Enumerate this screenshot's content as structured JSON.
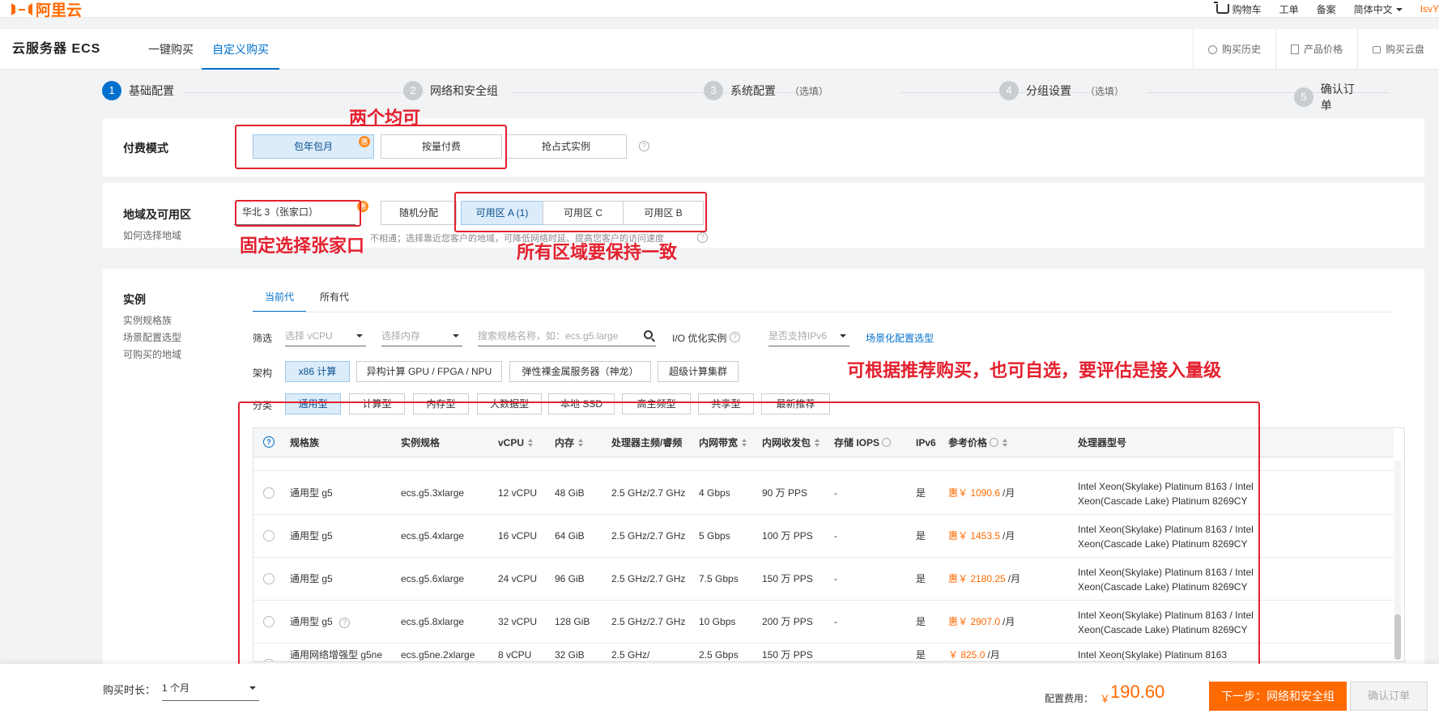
{
  "topbar": {
    "logo_text": "阿里云",
    "links": [
      "购物车",
      "工单",
      "备案",
      "简体中文"
    ],
    "user": "IsvY"
  },
  "product": {
    "title": "云服务器 ECS",
    "tabs": [
      {
        "label": "一键购买",
        "active": false
      },
      {
        "label": "自定义购买",
        "active": true
      }
    ],
    "right_links": [
      "购买历史",
      "产品价格",
      "购买云盘"
    ]
  },
  "steps": [
    {
      "num": "1",
      "label": "基础配置",
      "optional": "",
      "active": true
    },
    {
      "num": "2",
      "label": "网络和安全组",
      "optional": "",
      "active": false
    },
    {
      "num": "3",
      "label": "系统配置",
      "optional": "（选填）",
      "active": false
    },
    {
      "num": "4",
      "label": "分组设置",
      "optional": "（选填）",
      "active": false
    },
    {
      "num": "5",
      "label": "确认订单",
      "optional": "",
      "active": false
    }
  ],
  "billing": {
    "label": "付费模式",
    "options": [
      "包年包月",
      "按量付费",
      "抢占式实例"
    ],
    "selected": "包年包月",
    "badge": "惠"
  },
  "region": {
    "label": "地域及可用区",
    "help_link": "如何选择地域",
    "region_value": "华北 3（张家口）",
    "random": "随机分配",
    "zones": [
      "可用区 A (1)",
      "可用区 C",
      "可用区 B"
    ],
    "badge": "惠",
    "hint_a": "不相通；选择靠近您客户的地域，可降低网络时延、提高您客户的访问速度"
  },
  "annotations": {
    "billing_note": "两个均可",
    "region_note": "固定选择张家口",
    "zone_note": "所有区域要保持一致",
    "table_note": "可根据推荐购买，也可自选，要评估是接入量级",
    "color": "#e4202e"
  },
  "instance": {
    "label": "实例",
    "nav": [
      "实例规格族",
      "场景配置选型",
      "可购买的地域"
    ],
    "gen_tabs": [
      "当前代",
      "所有代"
    ],
    "filter_label": "筛选",
    "vcpu_placeholder": "选择 vCPU",
    "mem_placeholder": "选择内存",
    "search_placeholder": "搜索规格名称，如：ecs.g5.large",
    "io_label": "I/O 优化实例",
    "ipv6_placeholder": "是否支持IPv6",
    "scene_link": "场景化配置选型",
    "arch_label": "架构",
    "arch": [
      "x86 计算",
      "异构计算 GPU / FPGA / NPU",
      "弹性裸金属服务器（神龙）",
      "超级计算集群"
    ],
    "cat_label": "分类",
    "categories": [
      "通用型",
      "计算型",
      "内存型",
      "大数据型",
      "本地 SSD",
      "高主频型",
      "共享型",
      "最新推荐"
    ]
  },
  "table": {
    "headers": [
      "规格族",
      "实例规格",
      "vCPU",
      "内存",
      "处理器主频/睿频",
      "内网带宽",
      "内网收发包",
      "存储 IOPS",
      "IPv6",
      "参考价格",
      "处理器型号"
    ],
    "rows": [
      {
        "family": "通用型 g5",
        "spec": "ecs.g5.3xlarge",
        "vcpu": "12 vCPU",
        "mem": "48 GiB",
        "freq": "2.5 GHz/2.7 GHz",
        "bw": "4 Gbps",
        "pps": "90 万 PPS",
        "iops": "-",
        "ipv6": "是",
        "price": "惠￥ 1090.6",
        "unit": "/月",
        "proc": "Intel Xeon(Skylake) Platinum 8163 / Intel Xeon(Cascade Lake) Platinum 8269CY"
      },
      {
        "family": "通用型 g5",
        "spec": "ecs.g5.4xlarge",
        "vcpu": "16 vCPU",
        "mem": "64 GiB",
        "freq": "2.5 GHz/2.7 GHz",
        "bw": "5 Gbps",
        "pps": "100 万 PPS",
        "iops": "-",
        "ipv6": "是",
        "price": "惠￥ 1453.5",
        "unit": "/月",
        "proc": "Intel Xeon(Skylake) Platinum 8163 / Intel Xeon(Cascade Lake) Platinum 8269CY"
      },
      {
        "family": "通用型 g5",
        "spec": "ecs.g5.6xlarge",
        "vcpu": "24 vCPU",
        "mem": "96 GiB",
        "freq": "2.5 GHz/2.7 GHz",
        "bw": "7.5 Gbps",
        "pps": "150 万 PPS",
        "iops": "-",
        "ipv6": "是",
        "price": "惠￥ 2180.25",
        "unit": "/月",
        "proc": "Intel Xeon(Skylake) Platinum 8163 / Intel Xeon(Cascade Lake) Platinum 8269CY"
      },
      {
        "family": "通用型 g5",
        "spec": "ecs.g5.8xlarge",
        "vcpu": "32 vCPU",
        "mem": "128 GiB",
        "freq": "2.5 GHz/2.7 GHz",
        "bw": "10 Gbps",
        "pps": "200 万 PPS",
        "iops": "-",
        "ipv6": "是",
        "price": "惠￥ 2907.0",
        "unit": "/月",
        "proc": "Intel Xeon(Skylake) Platinum 8163 / Intel Xeon(Cascade Lake) Platinum 8269CY"
      },
      {
        "family": "通用网络增强型 g5ne",
        "spec": "ecs.g5ne.2xlarge",
        "vcpu": "8 vCPU",
        "mem": "32 GiB",
        "freq": "2.5 GHz/",
        "bw": "2.5 Gbps",
        "pps": "150 万 PPS",
        "iops": "",
        "ipv6": "是",
        "price": "￥ 825.0",
        "unit": "/月",
        "proc": "Intel Xeon(Skylake) Platinum 8163"
      }
    ]
  },
  "bottom": {
    "duration_label": "购买时长：",
    "duration_value": "1 个月",
    "fee_label": "配置费用：",
    "fee_currency": "￥",
    "fee_value": "190.60",
    "next_button": "下一步：网络和安全组",
    "confirm_button": "确认订单"
  }
}
